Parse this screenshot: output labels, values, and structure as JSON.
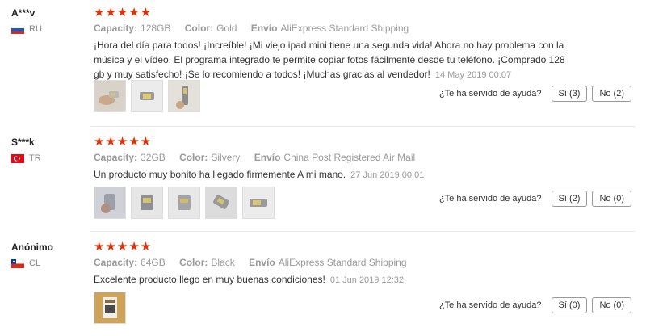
{
  "helpful_question": "¿Te ha servido de ayuda?",
  "reviews": [
    {
      "buyer": "A***v",
      "country": "RU",
      "stars": "★★★★★",
      "attrs": [
        {
          "key": "Capacity:",
          "value": "128GB"
        },
        {
          "key": "Color:",
          "value": "Gold"
        },
        {
          "key": "Envío",
          "value": "AliExpress Standard Shipping"
        }
      ],
      "text": "¡Hora del día para todos! ¡Increíble! ¡Mi viejo ipad mini tiene una segunda vida! Ahora no hay problema con la música y el vídeo. El programa integrado te permite copiar fotos fácilmente desde tu teléfono. ¡Comprado 128 gb y muy satisfecho! ¡Se lo recomiendo a todos! ¡Muchas gracias al vendedor!",
      "date": "14 May 2019 00:07",
      "yes": "Sí (3)",
      "no": "No (2)"
    },
    {
      "buyer": "S***k",
      "country": "TR",
      "stars": "★★★★★",
      "attrs": [
        {
          "key": "Capacity:",
          "value": "32GB"
        },
        {
          "key": "Color:",
          "value": "Silvery"
        },
        {
          "key": "Envío",
          "value": "China Post Registered Air Mail"
        }
      ],
      "text": "Un producto muy bonito ha llegado firmemente A mi mano.",
      "date": "27 Jun 2019 00:01",
      "yes": "Sí (2)",
      "no": "No (0)"
    },
    {
      "buyer": "Anónimo",
      "country": "CL",
      "stars": "★★★★★",
      "attrs": [
        {
          "key": "Capacity:",
          "value": "64GB"
        },
        {
          "key": "Color:",
          "value": "Black"
        },
        {
          "key": "Envío",
          "value": "AliExpress Standard Shipping"
        }
      ],
      "text": "Excelente producto llego en muy buenas condiciones!",
      "date": "01 Jun 2019 12:32",
      "yes": "Sí (0)",
      "no": "No (0)"
    }
  ],
  "colors": {
    "star": "#e62e04",
    "muted": "#999999",
    "text": "#333333"
  }
}
